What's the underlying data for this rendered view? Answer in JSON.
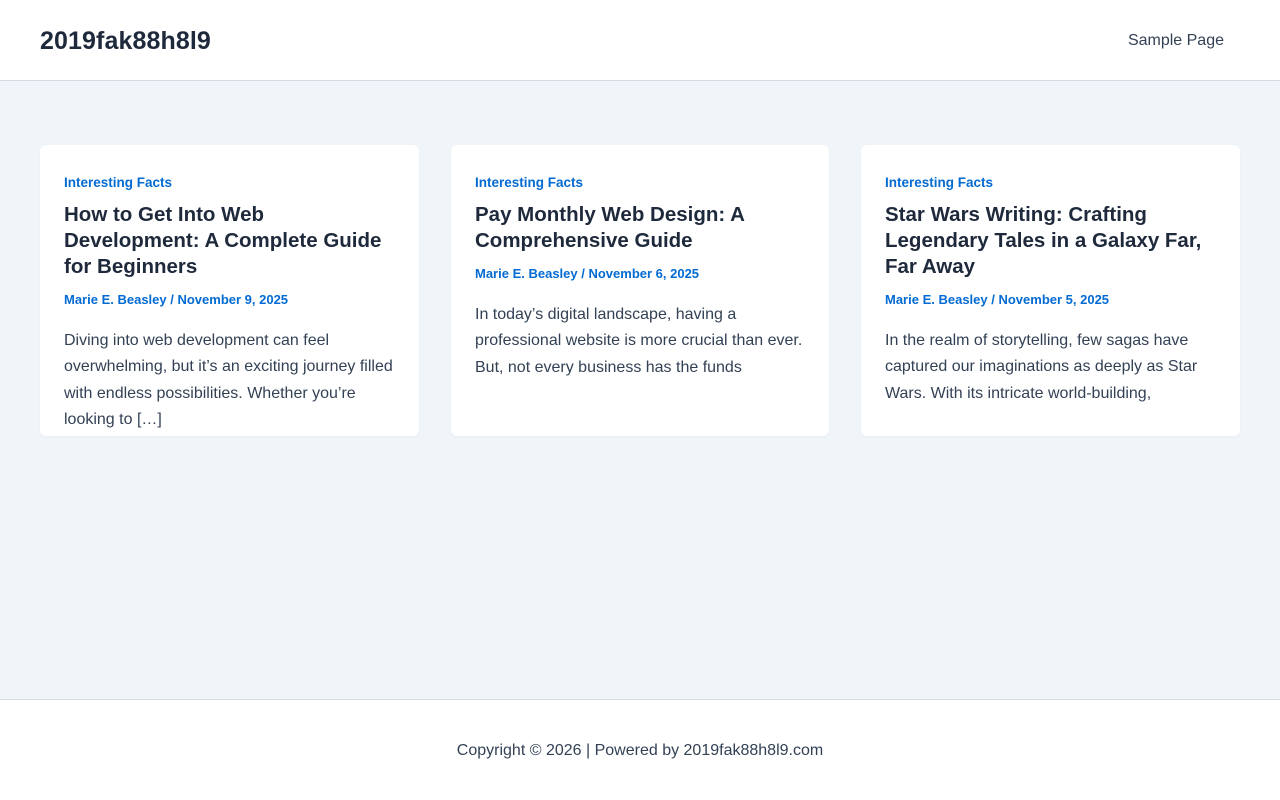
{
  "header": {
    "site_title": "2019fak88h8l9",
    "nav": [
      {
        "label": "Sample Page"
      }
    ]
  },
  "posts": [
    {
      "category": "Interesting Facts",
      "title": "How to Get Into Web Development: A Complete Guide for Beginners",
      "author": "Marie E. Beasley",
      "separator": " / ",
      "date": "November 9, 2025",
      "excerpt": "Diving into web development can feel overwhelming, but it’s an exciting journey filled with endless possibilities. Whether you’re looking to […]"
    },
    {
      "category": "Interesting Facts",
      "title": "Pay Monthly Web Design: A Comprehensive Guide",
      "author": "Marie E. Beasley",
      "separator": " / ",
      "date": "November 6, 2025",
      "excerpt": "In today’s digital landscape, having a professional website is more crucial than ever. But, not every business has the funds"
    },
    {
      "category": "Interesting Facts",
      "title": "Star Wars Writing: Crafting Legendary Tales in a Galaxy Far, Far Away",
      "author": "Marie E. Beasley",
      "separator": " / ",
      "date": "November 5, 2025",
      "excerpt": "In the realm of storytelling, few sagas have captured our imaginations as deeply as Star Wars. With its intricate world-building,"
    }
  ],
  "footer": {
    "text": "Copyright © 2026 | Powered by 2019fak88h8l9.com"
  },
  "colors": {
    "accent": "#046bd2",
    "heading": "#1e293b",
    "body_text": "#334155",
    "page_background": "#f0f5fa"
  }
}
